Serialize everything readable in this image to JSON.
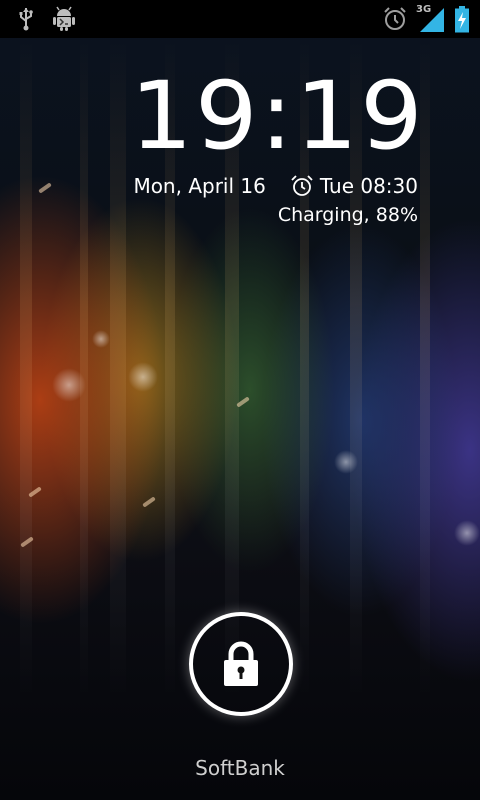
{
  "status_bar": {
    "network_type": "3G",
    "icons": [
      "usb-icon",
      "android-debug-icon",
      "alarm-icon",
      "signal-icon",
      "battery-charging-icon"
    ]
  },
  "lockscreen": {
    "time": "19:19",
    "date": "Mon, April 16",
    "next_alarm": "Tue 08:30",
    "charging_status": "Charging, 88%",
    "carrier": "SoftBank"
  },
  "colors": {
    "status_bar_bg": "#000000",
    "accent_blue": "#33b5e5",
    "text": "#ffffff"
  }
}
